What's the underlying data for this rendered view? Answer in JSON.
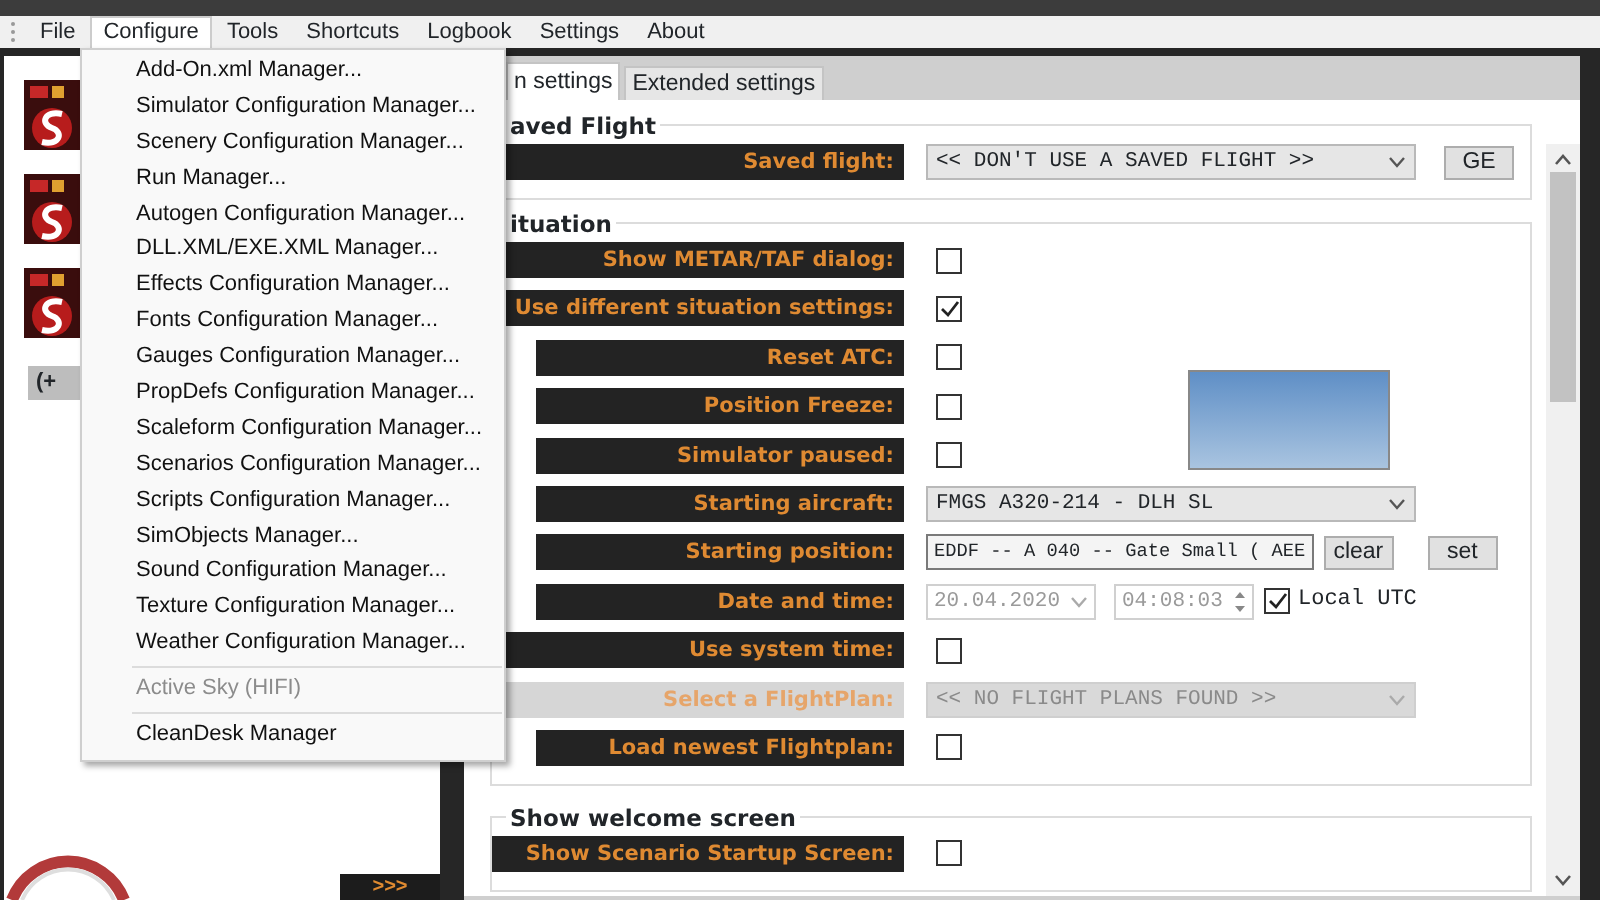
{
  "menubar": [
    {
      "label": "File",
      "open": false
    },
    {
      "label": "Configure",
      "open": true
    },
    {
      "label": "Tools",
      "open": false
    },
    {
      "label": "Shortcuts",
      "open": false
    },
    {
      "label": "Logbook",
      "open": false
    },
    {
      "label": "Settings",
      "open": false
    },
    {
      "label": "About",
      "open": false
    }
  ],
  "open_menu": [
    {
      "kind": "item",
      "label": "Add-On.xml Manager...",
      "disabled": false
    },
    {
      "kind": "item",
      "label": "Simulator Configuration Manager...",
      "disabled": false
    },
    {
      "kind": "item",
      "label": "Scenery Configuration Manager...",
      "disabled": false
    },
    {
      "kind": "item",
      "label": "Run Manager...",
      "disabled": false
    },
    {
      "kind": "item",
      "label": "Autogen Configuration Manager...",
      "disabled": false
    },
    {
      "kind": "item",
      "label": "DLL.XML/EXE.XML Manager...",
      "disabled": false
    },
    {
      "kind": "item",
      "label": "Effects Configuration Manager...",
      "disabled": false
    },
    {
      "kind": "item",
      "label": "Fonts Configuration Manager...",
      "disabled": false
    },
    {
      "kind": "item",
      "label": "Gauges Configuration Manager...",
      "disabled": false
    },
    {
      "kind": "item",
      "label": "PropDefs Configuration Manager...",
      "disabled": false
    },
    {
      "kind": "item",
      "label": "Scaleform Configuration Manager...",
      "disabled": false
    },
    {
      "kind": "item",
      "label": "Scenarios Configuration Manager...",
      "disabled": false
    },
    {
      "kind": "item",
      "label": "Scripts Configuration Manager...",
      "disabled": false
    },
    {
      "kind": "item",
      "label": "SimObjects Manager...",
      "disabled": false
    },
    {
      "kind": "item",
      "label": "Sound Configuration Manager...",
      "disabled": false
    },
    {
      "kind": "item",
      "label": "Texture Configuration Manager...",
      "disabled": false
    },
    {
      "kind": "item",
      "label": "Weather Configuration Manager...",
      "disabled": false
    },
    {
      "kind": "separator"
    },
    {
      "kind": "item",
      "label": "Active Sky (HIFI)",
      "disabled": true
    },
    {
      "kind": "separator"
    },
    {
      "kind": "item",
      "label": "CleanDesk Manager",
      "disabled": false
    }
  ],
  "left_panel": {
    "add_button": "(+",
    "expand_button": ">>>"
  },
  "tabs": [
    {
      "label": "n settings",
      "selected": true
    },
    {
      "label": "Extended settings",
      "selected": false
    }
  ],
  "groups": [
    {
      "title": "aved Flight",
      "photo": false,
      "rows": [
        {
          "kind": "select",
          "label": "Saved flight:",
          "indented": false,
          "disabled": false,
          "value": "<< DON'T USE A SAVED FLIGHT >>",
          "buttons": [
            "GE"
          ]
        }
      ]
    },
    {
      "title": "ituation",
      "photo": true,
      "rows": [
        {
          "kind": "checkbox",
          "label": "Show METAR/TAF dialog:",
          "indented": false,
          "disabled": false,
          "checked": false
        },
        {
          "kind": "checkbox",
          "label": "Use different situation settings:",
          "indented": false,
          "disabled": false,
          "checked": true
        },
        {
          "kind": "checkbox",
          "label": "Reset ATC:",
          "indented": true,
          "disabled": false,
          "checked": false
        },
        {
          "kind": "checkbox",
          "label": "Position Freeze:",
          "indented": true,
          "disabled": false,
          "checked": false
        },
        {
          "kind": "checkbox",
          "label": "Simulator paused:",
          "indented": true,
          "disabled": false,
          "checked": false
        },
        {
          "kind": "select",
          "label": "Starting aircraft:",
          "indented": true,
          "disabled": false,
          "value": "FMGS A320-214 - DLH SL"
        },
        {
          "kind": "text",
          "label": "Starting position:",
          "indented": true,
          "disabled": false,
          "value": "EDDF -- A 040 -- Gate Small  ( AEE",
          "buttons": [
            "clear",
            "set"
          ]
        },
        {
          "kind": "datetime",
          "label": "Date and time:",
          "indented": true,
          "disabled": false,
          "date": "20.04.2020",
          "time": "04:08:03",
          "fields_disabled": true,
          "utc_label": "Local UTC",
          "utc_checked": true
        },
        {
          "kind": "checkbox",
          "label": "Use system time:",
          "indented": false,
          "disabled": false,
          "checked": false
        },
        {
          "kind": "select",
          "label": "Select a FlightPlan:",
          "indented": false,
          "disabled": true,
          "value": "<< NO FLIGHT PLANS FOUND >>"
        },
        {
          "kind": "checkbox",
          "label": "Load newest Flightplan:",
          "indented": true,
          "disabled": false,
          "checked": false
        }
      ]
    },
    {
      "title": "Show welcome screen",
      "photo": false,
      "rows": [
        {
          "kind": "checkbox",
          "label": "Show Scenario Startup Screen:",
          "indented": false,
          "disabled": false,
          "checked": false
        }
      ]
    }
  ]
}
